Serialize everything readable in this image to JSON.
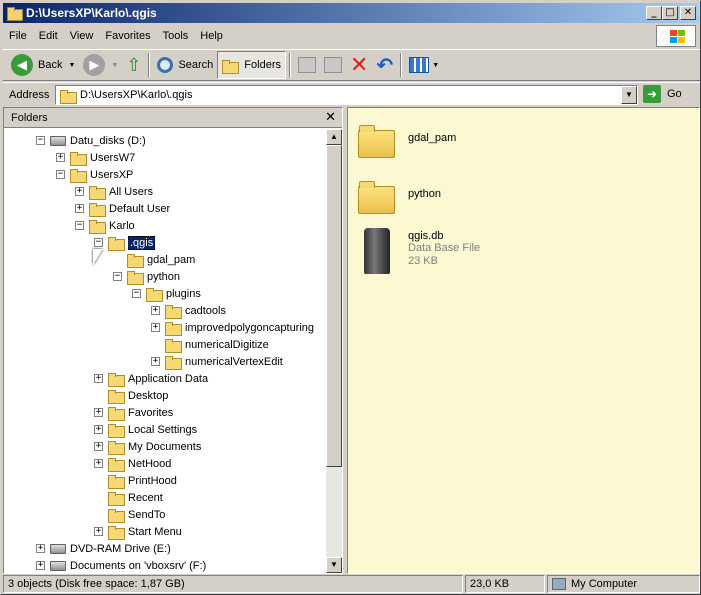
{
  "window": {
    "title": "D:\\UsersXP\\Karlo\\.qgis",
    "minimize_glyph": "_",
    "maximize_glyph": "□",
    "close_glyph": "✕"
  },
  "menu": [
    "File",
    "Edit",
    "View",
    "Favorites",
    "Tools",
    "Help"
  ],
  "toolbar": {
    "back_label": "Back",
    "search_label": "Search",
    "folders_label": "Folders",
    "back_icon": "back-arrow-icon",
    "forward_icon": "forward-arrow-icon",
    "up_icon": "up-folder-icon",
    "search_icon": "magnifier-icon",
    "move_icon": "move-to-icon",
    "copy_icon": "copy-to-icon",
    "delete_icon": "delete-x-icon",
    "undo_icon": "undo-icon",
    "views_icon": "views-icon"
  },
  "address": {
    "label": "Address",
    "value": "D:\\UsersXP\\Karlo\\.qgis",
    "go_label": "Go"
  },
  "folders_pane": {
    "title": "Folders",
    "tree": [
      {
        "label": "Datu_disks (D:)",
        "expander": "minus",
        "icon": "drive",
        "level": 0
      },
      {
        "label": "UsersW7",
        "expander": "plus",
        "icon": "folder",
        "level": 1
      },
      {
        "label": "UsersXP",
        "expander": "minus",
        "icon": "folder",
        "level": 1
      },
      {
        "label": "All Users",
        "expander": "plus",
        "icon": "folder",
        "level": 2
      },
      {
        "label": "Default User",
        "expander": "plus",
        "icon": "folder",
        "level": 2
      },
      {
        "label": "Karlo",
        "expander": "minus",
        "icon": "folder",
        "level": 2
      },
      {
        "label": ".qgis",
        "expander": "minus",
        "icon": "folder-open",
        "level": 3,
        "selected": true
      },
      {
        "label": "gdal_pam",
        "expander": "",
        "icon": "folder",
        "level": 4
      },
      {
        "label": "python",
        "expander": "minus",
        "icon": "folder",
        "level": 4
      },
      {
        "label": "plugins",
        "expander": "minus",
        "icon": "folder",
        "level": 5
      },
      {
        "label": "cadtools",
        "expander": "plus",
        "icon": "folder",
        "level": 6
      },
      {
        "label": "improvedpolygoncapturing",
        "expander": "plus",
        "icon": "folder",
        "level": 6
      },
      {
        "label": "numericalDigitize",
        "expander": "",
        "icon": "folder",
        "level": 6
      },
      {
        "label": "numericalVertexEdit",
        "expander": "plus",
        "icon": "folder",
        "level": 6
      },
      {
        "label": "Application Data",
        "expander": "plus",
        "icon": "folder",
        "level": 3
      },
      {
        "label": "Desktop",
        "expander": "",
        "icon": "folder",
        "level": 3
      },
      {
        "label": "Favorites",
        "expander": "plus",
        "icon": "folder",
        "level": 3
      },
      {
        "label": "Local Settings",
        "expander": "plus",
        "icon": "folder",
        "level": 3
      },
      {
        "label": "My Documents",
        "expander": "plus",
        "icon": "folder",
        "level": 3
      },
      {
        "label": "NetHood",
        "expander": "plus",
        "icon": "folder",
        "level": 3
      },
      {
        "label": "PrintHood",
        "expander": "",
        "icon": "folder",
        "level": 3
      },
      {
        "label": "Recent",
        "expander": "",
        "icon": "folder",
        "level": 3
      },
      {
        "label": "SendTo",
        "expander": "",
        "icon": "folder",
        "level": 3
      },
      {
        "label": "Start Menu",
        "expander": "plus",
        "icon": "folder",
        "level": 3
      },
      {
        "label": "DVD-RAM Drive (E:)",
        "expander": "plus",
        "icon": "drive",
        "level": 0
      },
      {
        "label": "Documents on 'vboxsrv' (F:)",
        "expander": "plus",
        "icon": "drive",
        "level": 0
      }
    ]
  },
  "content_items": [
    {
      "name": "gdal_pam",
      "type": "folder"
    },
    {
      "name": "python",
      "type": "folder"
    },
    {
      "name": "qgis.db",
      "type": "file",
      "subtitle": "Data Base File",
      "size": "23 KB"
    }
  ],
  "status": {
    "objects": "3 objects (Disk free space: 1,87 GB)",
    "size": "23,0 KB",
    "location": "My Computer"
  },
  "colors": {
    "title_start": "#0a246a",
    "title_end": "#a6caf0",
    "content_bg": "#fbf8d2",
    "folder": "#f6d875"
  }
}
